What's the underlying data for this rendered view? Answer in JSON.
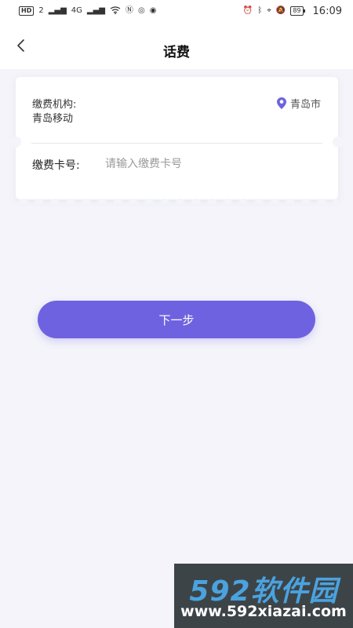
{
  "status_bar": {
    "hd_label": "HD",
    "sim_label": "2",
    "network_label": "4G",
    "battery_level": "89",
    "time": "16:09"
  },
  "nav": {
    "title": "话费"
  },
  "form": {
    "org_label": "缴费机构:",
    "org_value": "青岛移动",
    "city": "青岛市",
    "card_label": "缴费卡号:",
    "card_placeholder": "请输入缴费卡号",
    "card_value": ""
  },
  "actions": {
    "next_label": "下一步"
  },
  "watermark": {
    "brand": "592软件园",
    "url": "www.592xiazai.com"
  },
  "colors": {
    "accent": "#6f62e0",
    "background": "#f4f4fa",
    "card": "#ffffff"
  }
}
